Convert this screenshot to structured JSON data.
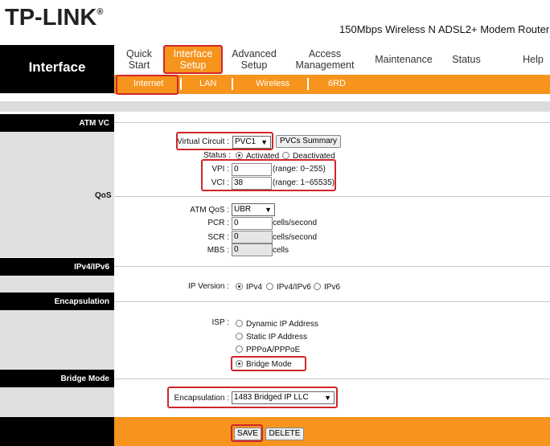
{
  "header": {
    "logo": "TP-LINK",
    "logo_mark": "®",
    "product": "150Mbps Wireless N ADSL2+ Modem Router",
    "section_title": "Interface"
  },
  "menu": {
    "quick_start_1": "Quick",
    "quick_start_2": "Start",
    "interface_setup_1": "Interface",
    "interface_setup_2": "Setup",
    "advanced_setup_1": "Advanced",
    "advanced_setup_2": "Setup",
    "access_management_1": "Access",
    "access_management_2": "Management",
    "maintenance": "Maintenance",
    "status": "Status",
    "help": "Help"
  },
  "submenu": {
    "internet": "Internet",
    "lan": "LAN",
    "wireless": "Wireless",
    "sixrd": "6RD"
  },
  "sections": {
    "atm_vc": "ATM VC",
    "qos": "QoS",
    "ipv4ipv6": "IPv4/IPv6",
    "encapsulation": "Encapsulation",
    "bridge_mode": "Bridge Mode"
  },
  "atm": {
    "virtual_circuit_label": "Virtual Circuit :",
    "virtual_circuit_value": "PVC1",
    "pvcs_summary": "PVCs Summary",
    "status_label": "Status :",
    "activated": "Activated",
    "deactivated": "Deactivated",
    "vpi_label": "VPI :",
    "vpi_value": "0",
    "vpi_range": "(range: 0~255)",
    "vci_label": "VCI :",
    "vci_value": "38",
    "vci_range": "(range: 1~65535)"
  },
  "qos": {
    "atm_qos_label": "ATM QoS :",
    "atm_qos_value": "UBR",
    "pcr_label": "PCR :",
    "pcr_value": "0",
    "scr_label": "SCR :",
    "scr_value": "0",
    "mbs_label": "MBS :",
    "mbs_value": "0",
    "cells_second": "cells/second",
    "cells": "cells"
  },
  "ip": {
    "version_label": "IP Version :",
    "ipv4": "IPv4",
    "ipv4ipv6": "IPv4/IPv6",
    "ipv6": "IPv6"
  },
  "encap": {
    "isp_label": "ISP :",
    "dynamic": "Dynamic IP Address",
    "static": "Static IP Address",
    "pppoa": "PPPoA/PPPoE",
    "bridge": "Bridge Mode"
  },
  "bridge": {
    "encapsulation_label": "Encapsulation :",
    "encapsulation_value": "1483 Bridged IP LLC"
  },
  "actions": {
    "save": "SAVE",
    "delete": "DELETE"
  },
  "colors": {
    "accent": "#f7941d",
    "highlight": "#d0262a"
  }
}
